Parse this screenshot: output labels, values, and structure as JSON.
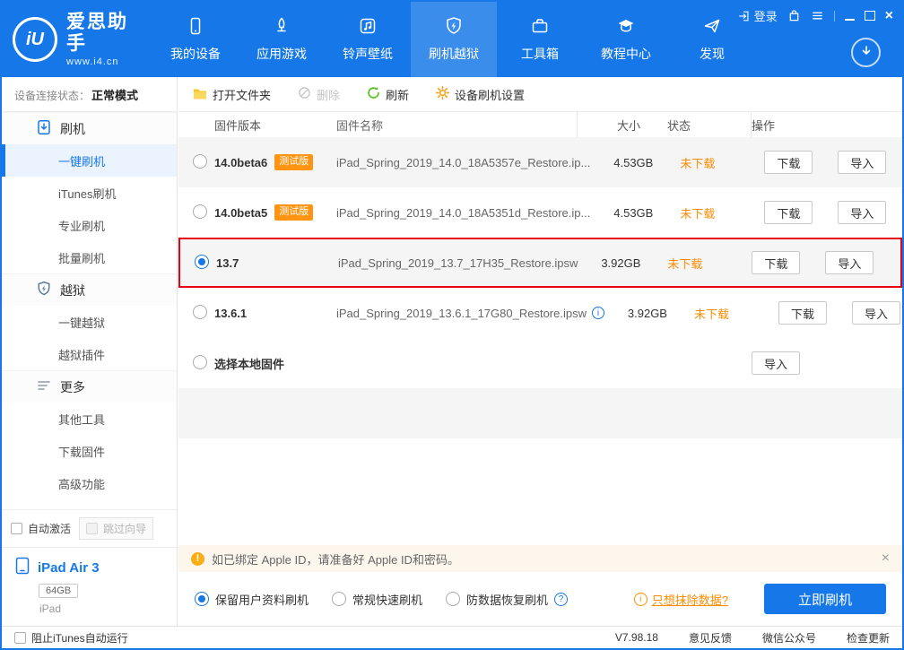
{
  "app": {
    "title": "爱思助手",
    "website": "www.i4.cn",
    "logo_glyph": "iU"
  },
  "colors": {
    "primary": "#1678E8",
    "status_orange": "#FF8C00",
    "badge_orange": "#FF9412",
    "highlight_red": "#E60012",
    "refresh_green": "#52C41A",
    "folder_yellow": "#F7C52E",
    "warning_bg": "#FDF6EC"
  },
  "topbar": {
    "login_label": "登录",
    "nav": [
      {
        "label": "我的设备"
      },
      {
        "label": "应用游戏"
      },
      {
        "label": "铃声壁纸"
      },
      {
        "label": "刷机越狱",
        "active": true
      },
      {
        "label": "工具箱"
      },
      {
        "label": "教程中心"
      },
      {
        "label": "发现"
      }
    ]
  },
  "sidebar": {
    "status_label": "设备连接状态：",
    "status_value": "正常模式",
    "items": [
      {
        "label": "刷机",
        "type": "section"
      },
      {
        "label": "一键刷机",
        "type": "item",
        "selected": true
      },
      {
        "label": "iTunes刷机",
        "type": "item"
      },
      {
        "label": "专业刷机",
        "type": "item"
      },
      {
        "label": "批量刷机",
        "type": "item"
      },
      {
        "label": "越狱",
        "type": "section"
      },
      {
        "label": "一键越狱",
        "type": "item"
      },
      {
        "label": "越狱插件",
        "type": "item"
      },
      {
        "label": "更多",
        "type": "section"
      },
      {
        "label": "其他工具",
        "type": "item"
      },
      {
        "label": "下载固件",
        "type": "item"
      },
      {
        "label": "高级功能",
        "type": "item"
      }
    ],
    "auto_activate_label": "自动激活",
    "skip_wizard_label": "跳过向导",
    "device": {
      "name": "iPad Air 3",
      "capacity": "64GB",
      "model": "iPad"
    }
  },
  "toolbar": {
    "open_folder": "打开文件夹",
    "delete": "删除",
    "refresh": "刷新",
    "flash_settings": "设备刷机设置"
  },
  "table": {
    "columns": {
      "version": "固件版本",
      "name": "固件名称",
      "size": "大小",
      "status": "状态",
      "action": "操作"
    },
    "download_label": "下载",
    "import_label": "导入",
    "rows": [
      {
        "version": "14.0beta6",
        "badge": "测试版",
        "name": "iPad_Spring_2019_14.0_18A5357e_Restore.ip...",
        "size": "4.53GB",
        "status": "未下载"
      },
      {
        "version": "14.0beta5",
        "badge": "测试版",
        "name": "iPad_Spring_2019_14.0_18A5351d_Restore.ip...",
        "size": "4.53GB",
        "status": "未下载"
      },
      {
        "version": "13.7",
        "name": "iPad_Spring_2019_13.7_17H35_Restore.ipsw",
        "size": "3.92GB",
        "status": "未下载",
        "selected": true,
        "highlighted": true
      },
      {
        "version": "13.6.1",
        "name": "iPad_Spring_2019_13.6.1_17G80_Restore.ipsw",
        "size": "3.92GB",
        "status": "未下载"
      },
      {
        "version": "选择本地固件"
      }
    ]
  },
  "warning": {
    "text": "如已绑定 Apple ID，请准备好 Apple ID和密码。"
  },
  "flash_options": {
    "options": [
      {
        "label": "保留用户资料刷机",
        "selected": true
      },
      {
        "label": "常规快速刷机"
      },
      {
        "label": "防数据恢复刷机"
      }
    ],
    "erase_link": "只想抹除数据?",
    "flash_button": "立即刷机"
  },
  "statusbar": {
    "block_itunes": "阻止iTunes自动运行",
    "version": "V7.98.18",
    "feedback": "意见反馈",
    "wechat": "微信公众号",
    "check_update": "检查更新"
  }
}
